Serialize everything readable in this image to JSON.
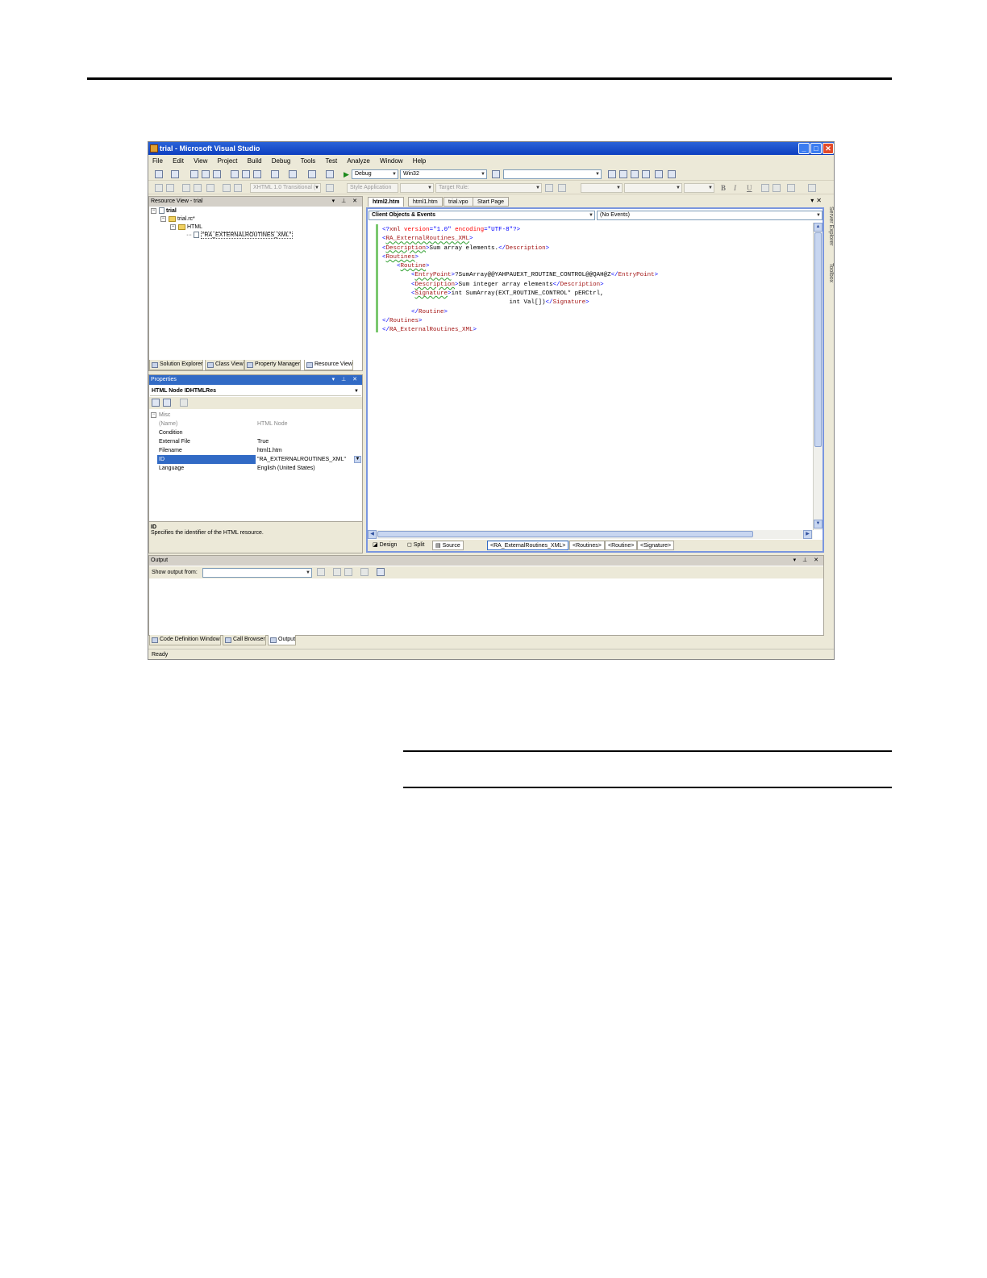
{
  "window": {
    "title": "trial - Microsoft Visual Studio",
    "buttons": [
      "_",
      "□",
      "✕"
    ]
  },
  "menu": [
    "File",
    "Edit",
    "View",
    "Project",
    "Build",
    "Debug",
    "Tools",
    "Test",
    "Analyze",
    "Window",
    "Help"
  ],
  "toolbar1": {
    "configuration": "Debug",
    "platform": "Win32",
    "find_box": ""
  },
  "toolbar2": {
    "doctype": "XHTML 1.0 Transitional (",
    "style_application": "Style Application",
    "target_rule": "Target Rule:",
    "bold": "B",
    "italic": "I",
    "underline": "U"
  },
  "resource_view": {
    "title": "Resource View - trial",
    "tree": {
      "root": "trial",
      "rc_file": "trial.rc*",
      "folder": "HTML",
      "resource": "\"RA_EXTERNALROUTINES_XML\""
    },
    "tabs": [
      "Solution Explorer",
      "Class View",
      "Property Manager",
      "Resource View"
    ]
  },
  "properties": {
    "title": "Properties",
    "object": "HTML Node IDHTMLRes",
    "category": "Misc",
    "rows": [
      {
        "name": "(Name)",
        "value": "HTML Node"
      },
      {
        "name": "Condition",
        "value": ""
      },
      {
        "name": "External File",
        "value": "True"
      },
      {
        "name": "Filename",
        "value": "html1.htm"
      },
      {
        "name": "ID",
        "value": "\"RA_EXTERNALROUTINES_XML\""
      },
      {
        "name": "Language",
        "value": "English (United States)"
      }
    ],
    "desc_title": "ID",
    "desc_text": "Specifies the identifier of the HTML resource."
  },
  "editor": {
    "tabs": [
      "html2.htm",
      "html1.htm",
      "trial.vpo",
      "Start Page"
    ],
    "objects_combo": "Client Objects & Events",
    "events_combo": "(No Events)",
    "code": {
      "l1_open": "<?",
      "l1_xml": "xml",
      "l1_attr1": "version",
      "l1_eq1": "=",
      "l1_val1": "\"1.0\"",
      "l1_attr2": "encoding",
      "l1_eq2": "=",
      "l1_val2": "\"UTF-8\"",
      "l1_close": "?>",
      "l2_tag": "RA_ExternalRoutines_XML",
      "l3_tag": "Description",
      "l3_text": "Sum array elements.",
      "l4_tag": "Routines",
      "l5_tag": "Routine",
      "l6_tag": "EntryPoint",
      "l6_text": "?SumArray@@YAHPAUEXT_ROUTINE_CONTROL@@QAH@Z",
      "l7_tag": "Description",
      "l7_text": "Sum integer array elements",
      "l8_tag": "Signature",
      "l8_text": "int SumArray(EXT_ROUTINE_CONTROL* pERCtrl,",
      "l9_text": "int Val[])",
      "l9_tag": "Signature",
      "l10_tag": "Routine",
      "l11_tag": "Routines",
      "l12_tag": "RA_ExternalRoutines_XML"
    },
    "view_buttons": [
      "Design",
      "Split",
      "Source"
    ],
    "breadcrumbs": [
      "<RA_ExternalRoutines_XML>",
      "<Routines>",
      "<Routine>",
      "<Signature>"
    ]
  },
  "side_tabs": [
    "Server Explorer",
    "Toolbox"
  ],
  "output": {
    "title": "Output",
    "show_from_label": "Show output from:",
    "tabs": [
      "Code Definition Window",
      "Call Browser",
      "Output"
    ]
  },
  "status": "Ready"
}
